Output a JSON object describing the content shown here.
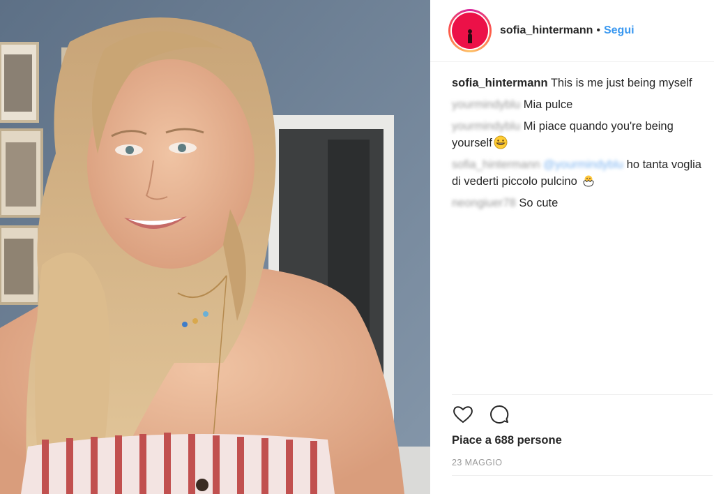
{
  "post": {
    "photo": {
      "icon": "selfie-photo"
    }
  },
  "header": {
    "username": "sofia_hintermann",
    "separator": "•",
    "follow_label": "Segui"
  },
  "comments": [
    {
      "user": "sofia_hintermann",
      "text": "This is me just being myself",
      "blurred": false
    },
    {
      "user": "yourmindyblu",
      "text": "Mia pulce",
      "blurred": true
    },
    {
      "user": "yourmindyblu",
      "text": "Mi piace quando you're being yourself",
      "blurred": true,
      "emoji": "grinning-emoji"
    },
    {
      "user": "sofia_hintermann",
      "mention": "@yourmindyblu",
      "text": "ho tanta voglia di vederti piccolo pulcino",
      "blurred": true,
      "emoji": "hatching-chick-emoji"
    },
    {
      "user": "neongiuer78",
      "text": "So cute",
      "blurred": true
    }
  ],
  "actions": {
    "like_icon": "heart-icon",
    "comment_icon": "comment-bubble-icon"
  },
  "likes": "Piace a 688 persone",
  "date": "23 MAGGIO",
  "colors": {
    "link": "#3897f0",
    "text": "#262626",
    "muted": "#999999",
    "border": "#efefef"
  }
}
